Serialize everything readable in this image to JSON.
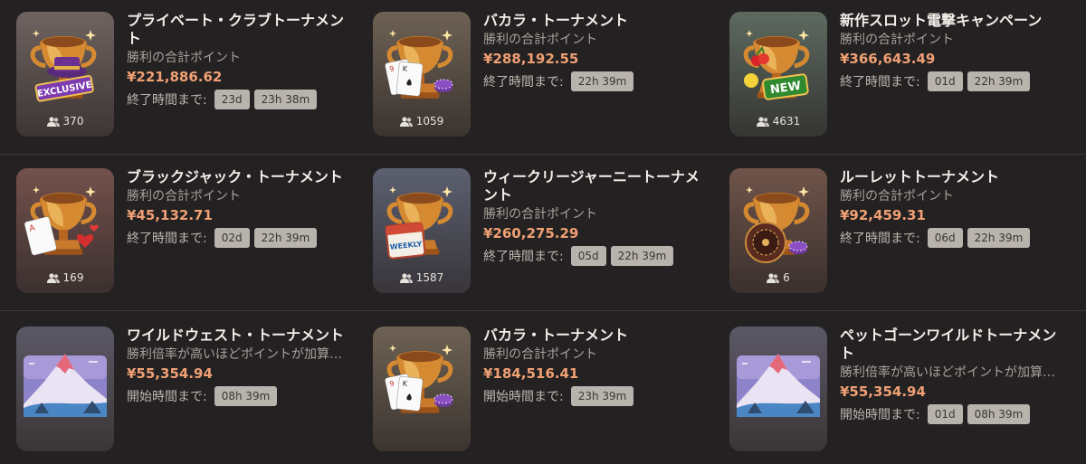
{
  "colors": {
    "background": "#232121",
    "prize": "#f0a074",
    "chip_bg": "#b9b3ad",
    "divider": "#3d3a38"
  },
  "tournaments": [
    {
      "title": "プライベート・クラブトーナメント",
      "subtitle": "勝利の合計ポイント",
      "prize": "¥221,886.62",
      "timer_label": "終了時間まで:",
      "chips": [
        "23d",
        "23h 38m"
      ],
      "players": "370",
      "art": "exclusive"
    },
    {
      "title": "バカラ・トーナメント",
      "subtitle": "勝利の合計ポイント",
      "prize": "¥288,192.55",
      "timer_label": "終了時間まで:",
      "chips": [
        "22h 39m"
      ],
      "players": "1059",
      "art": "cards"
    },
    {
      "title": "新作スロット電撃キャンペーン",
      "subtitle": "勝利の合計ポイント",
      "prize": "¥366,643.49",
      "timer_label": "終了時間まで:",
      "chips": [
        "01d",
        "22h 39m"
      ],
      "players": "4631",
      "art": "new"
    },
    {
      "title": "ブラックジャック・トーナメント",
      "subtitle": "勝利の合計ポイント",
      "prize": "¥45,132.71",
      "timer_label": "終了時間まで:",
      "chips": [
        "02d",
        "22h 39m"
      ],
      "players": "169",
      "art": "blackjack"
    },
    {
      "title": "ウィークリージャーニートーナメント",
      "subtitle": "勝利の合計ポイント",
      "prize": "¥260,275.29",
      "timer_label": "終了時間まで:",
      "chips": [
        "05d",
        "22h 39m"
      ],
      "players": "1587",
      "art": "weekly"
    },
    {
      "title": "ルーレットトーナメント",
      "subtitle": "勝利の合計ポイント",
      "prize": "¥92,459.31",
      "timer_label": "終了時間まで:",
      "chips": [
        "06d",
        "22h 39m"
      ],
      "players": "6",
      "art": "roulette"
    },
    {
      "title": "ワイルドウェスト・トーナメント",
      "subtitle": "勝利倍率が高いほどポイントが加算されます",
      "prize": "¥55,354.94",
      "timer_label": "開始時間まで:",
      "chips": [
        "08h 39m"
      ],
      "players": "",
      "art": "landscape"
    },
    {
      "title": "バカラ・トーナメント",
      "subtitle": "勝利の合計ポイント",
      "prize": "¥184,516.41",
      "timer_label": "開始時間まで:",
      "chips": [
        "23h 39m"
      ],
      "players": "",
      "art": "cards"
    },
    {
      "title": "ペットゴーンワイルドトーナメント",
      "subtitle": "勝利倍率が高いほどポイントが加算されます",
      "prize": "¥55,354.94",
      "timer_label": "開始時間まで:",
      "chips": [
        "01d",
        "08h 39m"
      ],
      "players": "",
      "art": "landscape"
    }
  ],
  "art_labels": {
    "exclusive": "EXCLUSIVE",
    "new": "NEW",
    "weekly": "WEEKLY"
  }
}
